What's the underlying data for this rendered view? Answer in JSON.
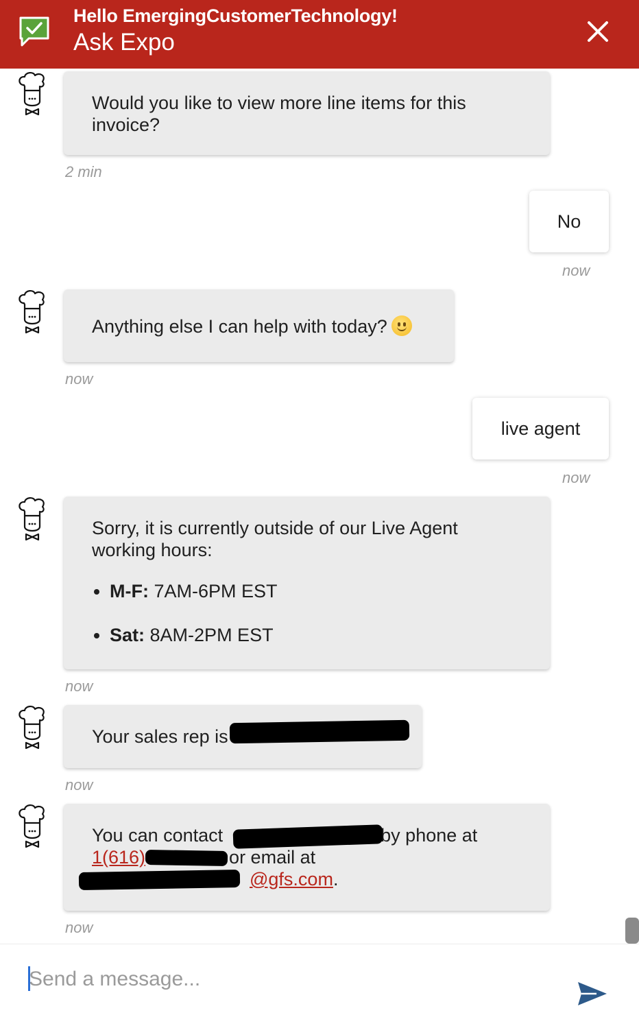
{
  "header": {
    "greeting": "Hello EmergingCustomerTechnology!",
    "title": "Ask Expo",
    "accent_color": "#b9261c",
    "logo_icon": "chat-check-icon",
    "close_icon": "close-icon"
  },
  "messages": [
    {
      "sender": "bot",
      "text_line1": "Would you like to view more line items for this",
      "text_line2": "invoice?",
      "time": "2 min"
    },
    {
      "sender": "user",
      "text": "No",
      "time": "now"
    },
    {
      "sender": "bot",
      "text": "Anything else I can help with today?",
      "time": "now"
    },
    {
      "sender": "user",
      "text": "live agent",
      "time": "now"
    },
    {
      "sender": "bot",
      "text_line1": "Sorry, it is currently outside of our Live Agent",
      "text_line2": "working hours:",
      "hours": [
        {
          "day": "M-F:",
          "time": "7AM-6PM EST"
        },
        {
          "day": "Sat:",
          "time": "8AM-2PM EST"
        }
      ],
      "time": "now"
    },
    {
      "sender": "bot",
      "text": "Your sales rep is",
      "time": "now"
    },
    {
      "sender": "bot",
      "text_pre": "You can contact",
      "text_mid": "by phone at",
      "phone_partial": "1(616)",
      "text_email": "or email at",
      "email_domain": "@gfs.com",
      "period": ".",
      "time": "now"
    }
  ],
  "composer": {
    "placeholder": "Send a message...",
    "send_icon": "send-icon"
  }
}
